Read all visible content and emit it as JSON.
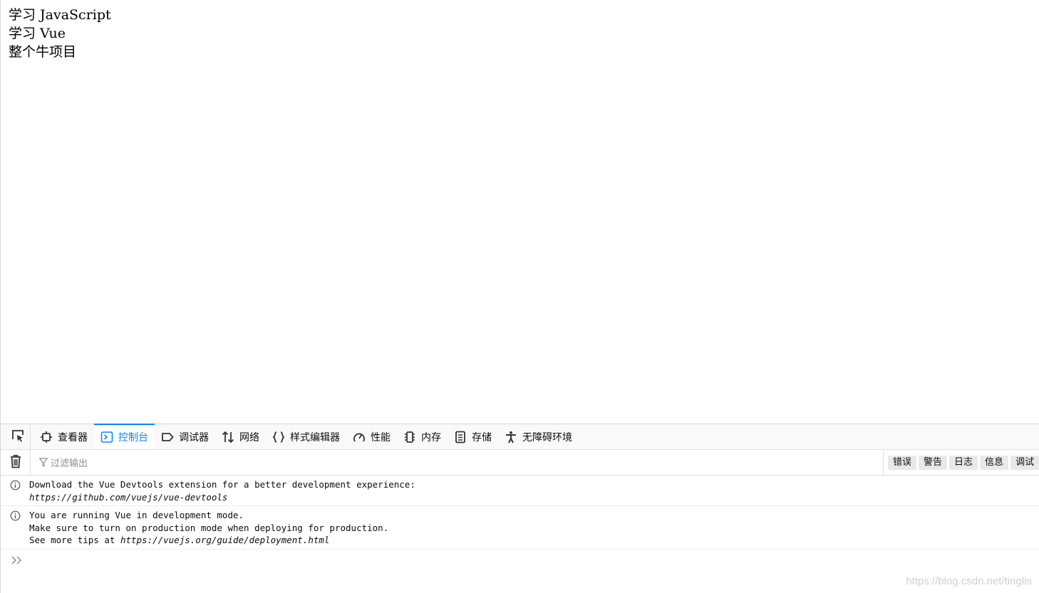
{
  "page": {
    "lines": [
      "学习 JavaScript",
      "学习 Vue",
      "整个牛项目"
    ]
  },
  "devtools": {
    "tabs": [
      {
        "label": "查看器",
        "icon": "inspector-icon"
      },
      {
        "label": "控制台",
        "icon": "console-icon"
      },
      {
        "label": "调试器",
        "icon": "debugger-icon"
      },
      {
        "label": "网络",
        "icon": "network-icon"
      },
      {
        "label": "样式编辑器",
        "icon": "style-editor-icon"
      },
      {
        "label": "性能",
        "icon": "performance-icon"
      },
      {
        "label": "内存",
        "icon": "memory-icon"
      },
      {
        "label": "存储",
        "icon": "storage-icon"
      },
      {
        "label": "无障碍环境",
        "icon": "accessibility-icon"
      }
    ],
    "active_tab": "控制台",
    "filter_placeholder": "过滤输出",
    "levels": [
      "错误",
      "警告",
      "日志",
      "信息",
      "调试"
    ]
  },
  "console": {
    "messages": [
      {
        "lines": [
          "Download the Vue Devtools extension for a better development experience:"
        ],
        "link": "https://github.com/vuejs/vue-devtools"
      },
      {
        "lines": [
          "You are running Vue in development mode.",
          "Make sure to turn on production mode when deploying for production.",
          "See more tips at "
        ],
        "link": "https://vuejs.org/guide/deployment.html"
      }
    ]
  },
  "watermark": "https://blog.csdn.net/tinglis",
  "colors": {
    "accent": "#0a84ff",
    "toolbar_bg": "#f9f9fa",
    "border": "#e0e0e2"
  }
}
